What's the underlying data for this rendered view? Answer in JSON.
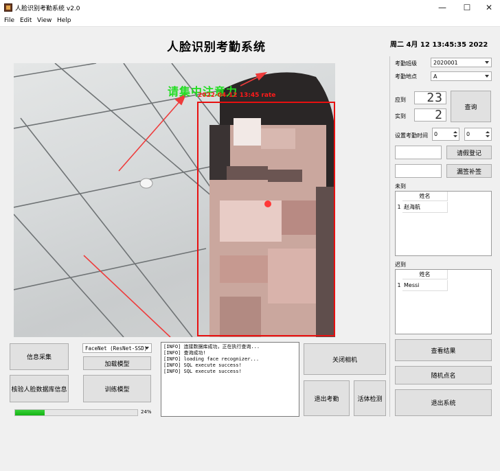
{
  "window": {
    "title": "人脸识别考勤系统 v2.0"
  },
  "menu": [
    "File",
    "Edit",
    "View",
    "Help"
  ],
  "window_buttons": {
    "minimize": "—",
    "maximize": "☐",
    "close": "✕"
  },
  "heading": "人脸识别考勤系统",
  "clock": "周二 4月 12 13:45:35 2022",
  "camera": {
    "overlay_text": "请集中注意力",
    "overlay_info": "2022-04-12 13:45 rate"
  },
  "left_controls": {
    "collect_button": "信息采集",
    "verify_db_button": "核验人脸数据库信息",
    "model_select": "FaceNet (ResNet-SSD)",
    "load_model_button": "加载模型",
    "train_model_button": "训练模型",
    "progress_percent": 24,
    "progress_label": "24%"
  },
  "log_lines": [
    "[INFO] 连接数据库成功，正在执行查询...",
    "[INFO] 查询成功!",
    "[INFO] loading face recognizer...",
    "[INFO] SQL execute success!",
    "[INFO] SQL execute success!"
  ],
  "center_buttons": {
    "close_camera": "关闭相机",
    "exit_attendance": "退出考勤",
    "liveness": "活体检测"
  },
  "right_panel": {
    "class_label": "考勤班级",
    "class_value": "2020001",
    "location_label": "考勤地点",
    "location_value": "A",
    "expected_label": "应到",
    "expected_value": "23",
    "actual_label": "实到",
    "actual_value": "2",
    "query_button": "查询",
    "set_time_label": "设置考勤时间",
    "time_hour": "0",
    "time_minute": "0",
    "leave_button": "请假登记",
    "makeup_button": "漏签补签",
    "absent_label": "未到",
    "absent_header": "姓名",
    "absent_rows": [
      {
        "index": "1",
        "name": "赵海航"
      }
    ],
    "late_label": "迟到",
    "late_header": "姓名",
    "late_rows": [
      {
        "index": "1",
        "name": "Messi"
      }
    ],
    "view_results_button": "查看结果",
    "random_call_button": "随机点名",
    "exit_system_button": "退出系统"
  }
}
